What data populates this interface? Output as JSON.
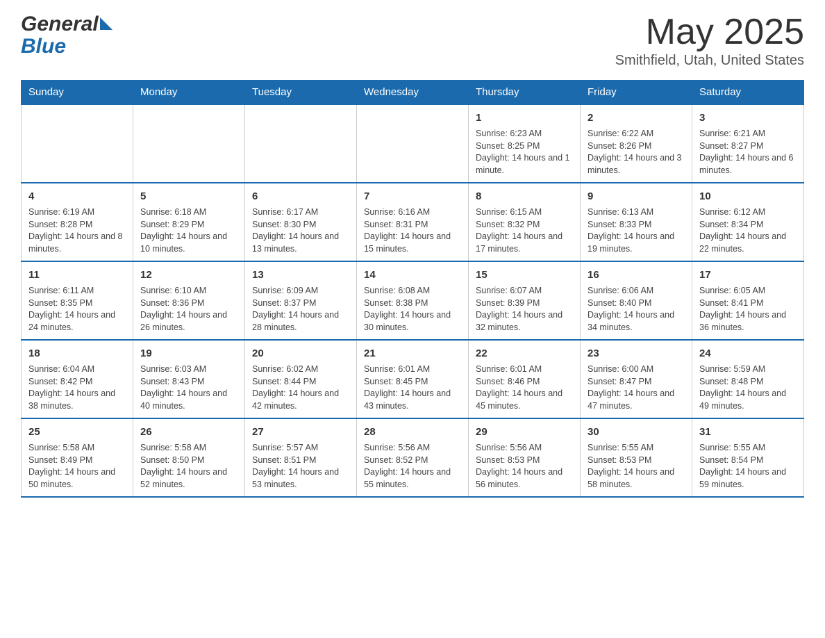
{
  "header": {
    "logo": {
      "general": "General",
      "blue": "Blue"
    },
    "title": "May 2025",
    "location": "Smithfield, Utah, United States"
  },
  "calendar": {
    "days_of_week": [
      "Sunday",
      "Monday",
      "Tuesday",
      "Wednesday",
      "Thursday",
      "Friday",
      "Saturday"
    ],
    "weeks": [
      [
        {
          "day": "",
          "info": ""
        },
        {
          "day": "",
          "info": ""
        },
        {
          "day": "",
          "info": ""
        },
        {
          "day": "",
          "info": ""
        },
        {
          "day": "1",
          "info": "Sunrise: 6:23 AM\nSunset: 8:25 PM\nDaylight: 14 hours and 1 minute."
        },
        {
          "day": "2",
          "info": "Sunrise: 6:22 AM\nSunset: 8:26 PM\nDaylight: 14 hours and 3 minutes."
        },
        {
          "day": "3",
          "info": "Sunrise: 6:21 AM\nSunset: 8:27 PM\nDaylight: 14 hours and 6 minutes."
        }
      ],
      [
        {
          "day": "4",
          "info": "Sunrise: 6:19 AM\nSunset: 8:28 PM\nDaylight: 14 hours and 8 minutes."
        },
        {
          "day": "5",
          "info": "Sunrise: 6:18 AM\nSunset: 8:29 PM\nDaylight: 14 hours and 10 minutes."
        },
        {
          "day": "6",
          "info": "Sunrise: 6:17 AM\nSunset: 8:30 PM\nDaylight: 14 hours and 13 minutes."
        },
        {
          "day": "7",
          "info": "Sunrise: 6:16 AM\nSunset: 8:31 PM\nDaylight: 14 hours and 15 minutes."
        },
        {
          "day": "8",
          "info": "Sunrise: 6:15 AM\nSunset: 8:32 PM\nDaylight: 14 hours and 17 minutes."
        },
        {
          "day": "9",
          "info": "Sunrise: 6:13 AM\nSunset: 8:33 PM\nDaylight: 14 hours and 19 minutes."
        },
        {
          "day": "10",
          "info": "Sunrise: 6:12 AM\nSunset: 8:34 PM\nDaylight: 14 hours and 22 minutes."
        }
      ],
      [
        {
          "day": "11",
          "info": "Sunrise: 6:11 AM\nSunset: 8:35 PM\nDaylight: 14 hours and 24 minutes."
        },
        {
          "day": "12",
          "info": "Sunrise: 6:10 AM\nSunset: 8:36 PM\nDaylight: 14 hours and 26 minutes."
        },
        {
          "day": "13",
          "info": "Sunrise: 6:09 AM\nSunset: 8:37 PM\nDaylight: 14 hours and 28 minutes."
        },
        {
          "day": "14",
          "info": "Sunrise: 6:08 AM\nSunset: 8:38 PM\nDaylight: 14 hours and 30 minutes."
        },
        {
          "day": "15",
          "info": "Sunrise: 6:07 AM\nSunset: 8:39 PM\nDaylight: 14 hours and 32 minutes."
        },
        {
          "day": "16",
          "info": "Sunrise: 6:06 AM\nSunset: 8:40 PM\nDaylight: 14 hours and 34 minutes."
        },
        {
          "day": "17",
          "info": "Sunrise: 6:05 AM\nSunset: 8:41 PM\nDaylight: 14 hours and 36 minutes."
        }
      ],
      [
        {
          "day": "18",
          "info": "Sunrise: 6:04 AM\nSunset: 8:42 PM\nDaylight: 14 hours and 38 minutes."
        },
        {
          "day": "19",
          "info": "Sunrise: 6:03 AM\nSunset: 8:43 PM\nDaylight: 14 hours and 40 minutes."
        },
        {
          "day": "20",
          "info": "Sunrise: 6:02 AM\nSunset: 8:44 PM\nDaylight: 14 hours and 42 minutes."
        },
        {
          "day": "21",
          "info": "Sunrise: 6:01 AM\nSunset: 8:45 PM\nDaylight: 14 hours and 43 minutes."
        },
        {
          "day": "22",
          "info": "Sunrise: 6:01 AM\nSunset: 8:46 PM\nDaylight: 14 hours and 45 minutes."
        },
        {
          "day": "23",
          "info": "Sunrise: 6:00 AM\nSunset: 8:47 PM\nDaylight: 14 hours and 47 minutes."
        },
        {
          "day": "24",
          "info": "Sunrise: 5:59 AM\nSunset: 8:48 PM\nDaylight: 14 hours and 49 minutes."
        }
      ],
      [
        {
          "day": "25",
          "info": "Sunrise: 5:58 AM\nSunset: 8:49 PM\nDaylight: 14 hours and 50 minutes."
        },
        {
          "day": "26",
          "info": "Sunrise: 5:58 AM\nSunset: 8:50 PM\nDaylight: 14 hours and 52 minutes."
        },
        {
          "day": "27",
          "info": "Sunrise: 5:57 AM\nSunset: 8:51 PM\nDaylight: 14 hours and 53 minutes."
        },
        {
          "day": "28",
          "info": "Sunrise: 5:56 AM\nSunset: 8:52 PM\nDaylight: 14 hours and 55 minutes."
        },
        {
          "day": "29",
          "info": "Sunrise: 5:56 AM\nSunset: 8:53 PM\nDaylight: 14 hours and 56 minutes."
        },
        {
          "day": "30",
          "info": "Sunrise: 5:55 AM\nSunset: 8:53 PM\nDaylight: 14 hours and 58 minutes."
        },
        {
          "day": "31",
          "info": "Sunrise: 5:55 AM\nSunset: 8:54 PM\nDaylight: 14 hours and 59 minutes."
        }
      ]
    ]
  }
}
